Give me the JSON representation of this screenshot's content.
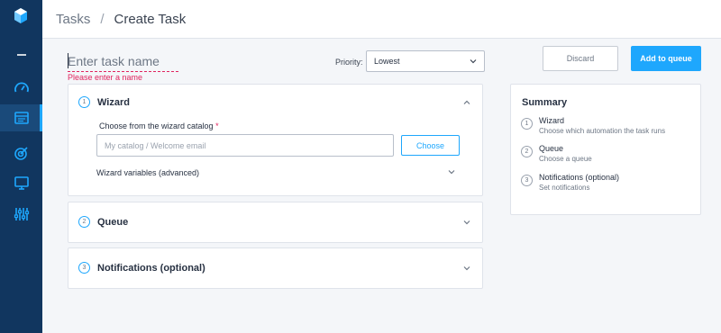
{
  "breadcrumb": {
    "parent": "Tasks",
    "separator": "/",
    "current": "Create Task"
  },
  "task_name": {
    "placeholder": "Enter task name",
    "error": "Please enter a name"
  },
  "priority": {
    "label": "Priority:",
    "selected": "Lowest"
  },
  "actions": {
    "discard": "Discard",
    "add": "Add to queue"
  },
  "sections": {
    "wizard": {
      "number": "1",
      "title": "Wizard",
      "catalog_label": "Choose from the wizard catalog",
      "required_mark": "*",
      "catalog_placeholder": "My catalog / Welcome email",
      "choose_label": "Choose",
      "advanced_label": "Wizard variables (advanced)"
    },
    "queue": {
      "number": "2",
      "title": "Queue"
    },
    "notifications": {
      "number": "3",
      "title": "Notifications (optional)"
    }
  },
  "summary": {
    "title": "Summary",
    "steps": [
      {
        "number": "1",
        "name": "Wizard",
        "desc": "Choose which automation the task runs"
      },
      {
        "number": "2",
        "name": "Queue",
        "desc": "Choose a queue"
      },
      {
        "number": "3",
        "name": "Notifications (optional)",
        "desc": "Set notifications"
      }
    ]
  },
  "sidebar": {
    "icons": [
      "logo-icon",
      "collapse-icon",
      "dashboard-icon",
      "tasks-icon",
      "target-icon",
      "monitor-icon",
      "settings-sliders-icon"
    ]
  },
  "colors": {
    "accent": "#1ea7fd",
    "sidebar": "#11365f",
    "error": "#e0245e"
  }
}
